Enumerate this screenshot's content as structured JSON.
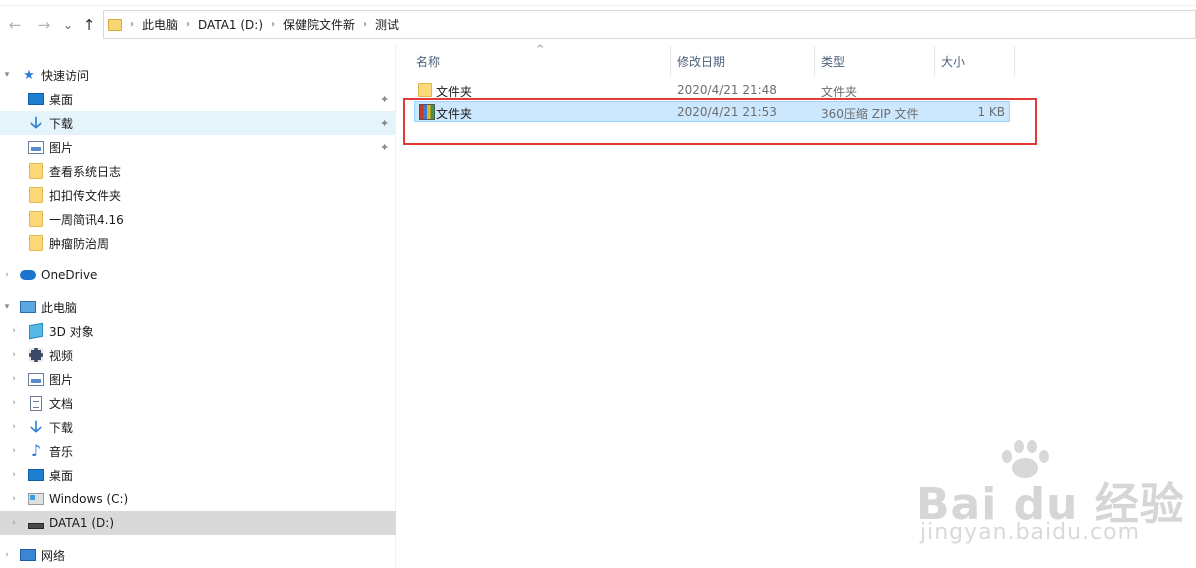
{
  "address": {
    "nav": {
      "back": "←",
      "forward": "→",
      "recent": "⌄",
      "up": "↑"
    },
    "separator": "›",
    "breadcrumbs": [
      "此电脑",
      "DATA1 (D:)",
      "保健院文件新",
      "测试"
    ]
  },
  "sidebar": {
    "quick_access": {
      "label": "快速访问",
      "items": [
        {
          "label": "桌面",
          "icon": "desktop-icon",
          "pinned": true
        },
        {
          "label": "下载",
          "icon": "download-icon",
          "pinned": true
        },
        {
          "label": "图片",
          "icon": "pictures-icon",
          "pinned": true
        },
        {
          "label": "查看系统日志",
          "icon": "folder-icon"
        },
        {
          "label": "扣扣传文件夹",
          "icon": "folder-icon"
        },
        {
          "label": "一周简讯4.16",
          "icon": "folder-icon"
        },
        {
          "label": "肿瘤防治周",
          "icon": "folder-icon"
        }
      ]
    },
    "onedrive": {
      "label": "OneDrive"
    },
    "this_pc": {
      "label": "此电脑",
      "items": [
        {
          "label": "3D 对象",
          "icon": "3d-objects-icon"
        },
        {
          "label": "视频",
          "icon": "video-icon"
        },
        {
          "label": "图片",
          "icon": "pictures-icon"
        },
        {
          "label": "文档",
          "icon": "document-icon"
        },
        {
          "label": "下载",
          "icon": "download-icon"
        },
        {
          "label": "音乐",
          "icon": "music-icon"
        },
        {
          "label": "桌面",
          "icon": "desktop-icon"
        },
        {
          "label": "Windows (C:)",
          "icon": "windows-drive-icon"
        },
        {
          "label": "DATA1 (D:)",
          "icon": "drive-icon"
        }
      ]
    },
    "network": {
      "label": "网络"
    },
    "pin_glyph": "📌"
  },
  "columns": {
    "name": "名称",
    "modified": "修改日期",
    "type": "类型",
    "size": "大小",
    "sort_arrow": "^"
  },
  "files": [
    {
      "name": "文件夹",
      "modified": "2020/4/21 21:48",
      "type": "文件夹",
      "size": "",
      "icon": "folder-icon"
    },
    {
      "name": "文件夹",
      "modified": "2020/4/21 21:53",
      "type": "360压缩 ZIP 文件",
      "size": "1 KB",
      "icon": "zip-archive-icon"
    }
  ],
  "watermark": {
    "logo": "Bai du 经验",
    "sub": "jingyan.baidu.com"
  },
  "colors": {
    "highlight": "#e53935",
    "selection": "#cce8ff",
    "nav_selected": "#e5f3fb",
    "drive_selected": "#d9d9d9"
  }
}
